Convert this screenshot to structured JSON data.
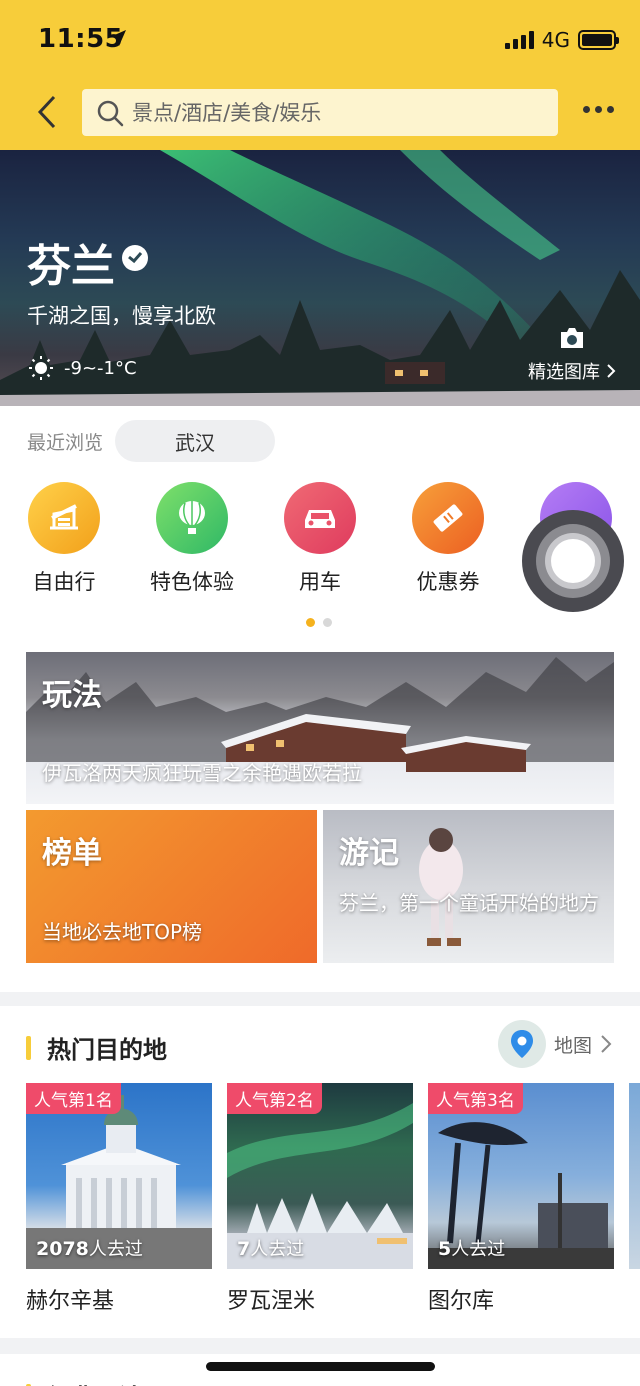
{
  "status": {
    "time": "11:55",
    "network": "4G"
  },
  "search": {
    "placeholder": "景点/酒店/美食/娱乐"
  },
  "hero": {
    "title": "芬兰",
    "subtitle": "千湖之国，慢享北欧",
    "weather": "-9~-1°C",
    "gallery_label": "精选图库"
  },
  "recent": {
    "label": "最近浏览",
    "item": "武汉"
  },
  "categories": [
    {
      "label": "自由行",
      "icon": "plane-icon",
      "color": "#f5b21e"
    },
    {
      "label": "特色体验",
      "icon": "balloon-icon",
      "color": "#4cc760"
    },
    {
      "label": "用车",
      "icon": "car-icon",
      "color": "#ea4f67"
    },
    {
      "label": "优惠券",
      "icon": "ticket-icon",
      "color": "#f07a26"
    },
    {
      "label": "",
      "icon": "card-icon",
      "color": "#a46ef0"
    }
  ],
  "features": {
    "play": {
      "title": "玩法",
      "desc": "伊瓦洛两天疯狂玩雪之余艳遇欧若拉"
    },
    "rank": {
      "title": "榜单",
      "desc": "当地必去地TOP榜"
    },
    "travel": {
      "title": "游记",
      "desc": "芬兰，第一个童话开始的地方"
    }
  },
  "hot": {
    "title": "热门目的地",
    "map_label": "地图",
    "items": [
      {
        "badge": "人气第1名",
        "count": "2078",
        "suffix": "人去过",
        "name": "赫尔辛基"
      },
      {
        "badge": "人气第2名",
        "count": "7",
        "suffix": "人去过",
        "name": "罗瓦涅米"
      },
      {
        "badge": "人气第3名",
        "count": "5",
        "suffix": "人去过",
        "name": "图尔库"
      }
    ]
  },
  "next_section": {
    "title": "经典玩法"
  }
}
